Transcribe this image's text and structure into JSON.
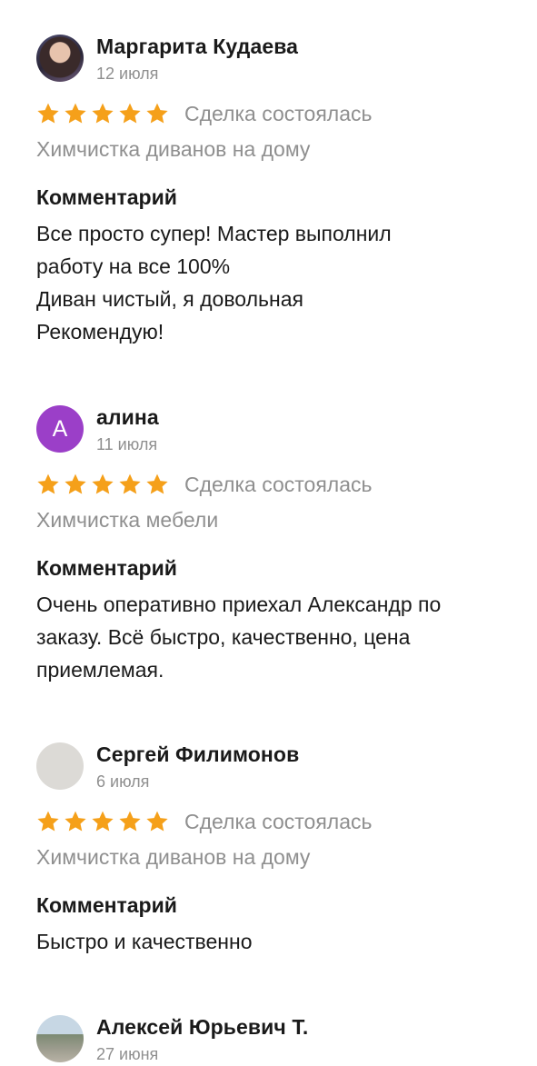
{
  "reviews": [
    {
      "author": "Маргарита Кудаева",
      "date": "12 июля",
      "avatar": "photo",
      "rating": 5,
      "deal_status": "Сделка состоялась",
      "service": "Химчистка диванов на дому",
      "comment_heading": "Комментарий",
      "comment": "Все просто супер! Мастер выполнил\nработу на все 100%\nДиван чистый, я довольная\nРекомендую!"
    },
    {
      "author": "алина",
      "date": "11 июля",
      "avatar": "letter",
      "avatar_letter": "А",
      "rating": 5,
      "deal_status": "Сделка состоялась",
      "service": "Химчистка мебели",
      "comment_heading": "Комментарий",
      "comment": "Очень оперативно приехал Александр по\nзаказу. Всё быстро, качественно, цена\nприемлемая."
    },
    {
      "author": "Сергей Филимонов",
      "date": "6 июля",
      "avatar": "empty",
      "rating": 5,
      "deal_status": "Сделка состоялась",
      "service": "Химчистка диванов на дому",
      "comment_heading": "Комментарий",
      "comment": "Быстро и качественно"
    },
    {
      "author": "Алексей Юрьевич Т.",
      "date": "27 июня",
      "avatar": "photo"
    }
  ],
  "colors": {
    "star": "#f5a01a",
    "muted_text": "#8f8f8f",
    "avatar_letter_bg": "#9b3fc8"
  },
  "icons": {
    "star": "star-icon"
  }
}
